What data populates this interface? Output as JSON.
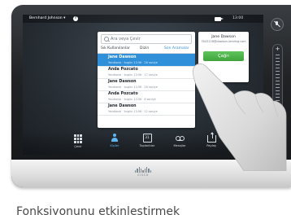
{
  "topbar": {
    "user_name": "Bernhard Johnson ▾",
    "help_symbol": "?",
    "clock": "13:00"
  },
  "contacts_panel": {
    "search_placeholder": "Ara veya Çevir",
    "tabs": [
      "Sık Kullanılanlar",
      "Dizin",
      "Son Aramalar"
    ],
    "active_tab_index": 2,
    "rows": [
      {
        "name": "Jane Dawson",
        "detail": "Yanıtlandı · bugün 13:56 · 28 saniye",
        "selected": true
      },
      {
        "name": "Anda Pozcato",
        "detail": "Yanıtlandı · bugün 13:56 · 17 saniye",
        "selected": false
      },
      {
        "name": "Jane Dawson",
        "detail": "Yanıtlandı · bugün 13:56 · 28 saniye",
        "selected": false
      },
      {
        "name": "Anda Pozcato",
        "detail": "Yanıtlandı · bugün 13:56 · 8 saniye",
        "selected": false
      },
      {
        "name": "Jane Dawson",
        "detail": "Yanıtlandı · bugün 13:56 · 22 saniye",
        "selected": false
      }
    ]
  },
  "detail_card": {
    "name": "Jane Dawson",
    "address": "7843128@dawson-lending.com",
    "call_label": "Çağrı"
  },
  "bottom_nav": [
    {
      "label": "Çevir",
      "icon": "grid-icon",
      "active": false
    },
    {
      "label": "Kişiler",
      "icon": "person-icon",
      "active": true
    },
    {
      "label": "Toplantılar",
      "icon": "calendar-icon",
      "active": false
    },
    {
      "label": "Mesajlar",
      "icon": "voicemail-icon",
      "active": false
    },
    {
      "label": "Paylaş",
      "icon": "share-icon",
      "active": false
    }
  ],
  "calendar_day": "31",
  "volume": {
    "plus": "+",
    "minus": "−"
  },
  "device_logo": "cisco",
  "caption": "Fonksiyonunu etkinleştirmek",
  "colors": {
    "accent_blue": "#2f8fd8",
    "call_green": "#3fa33b",
    "screen_bg": "#23292f"
  }
}
